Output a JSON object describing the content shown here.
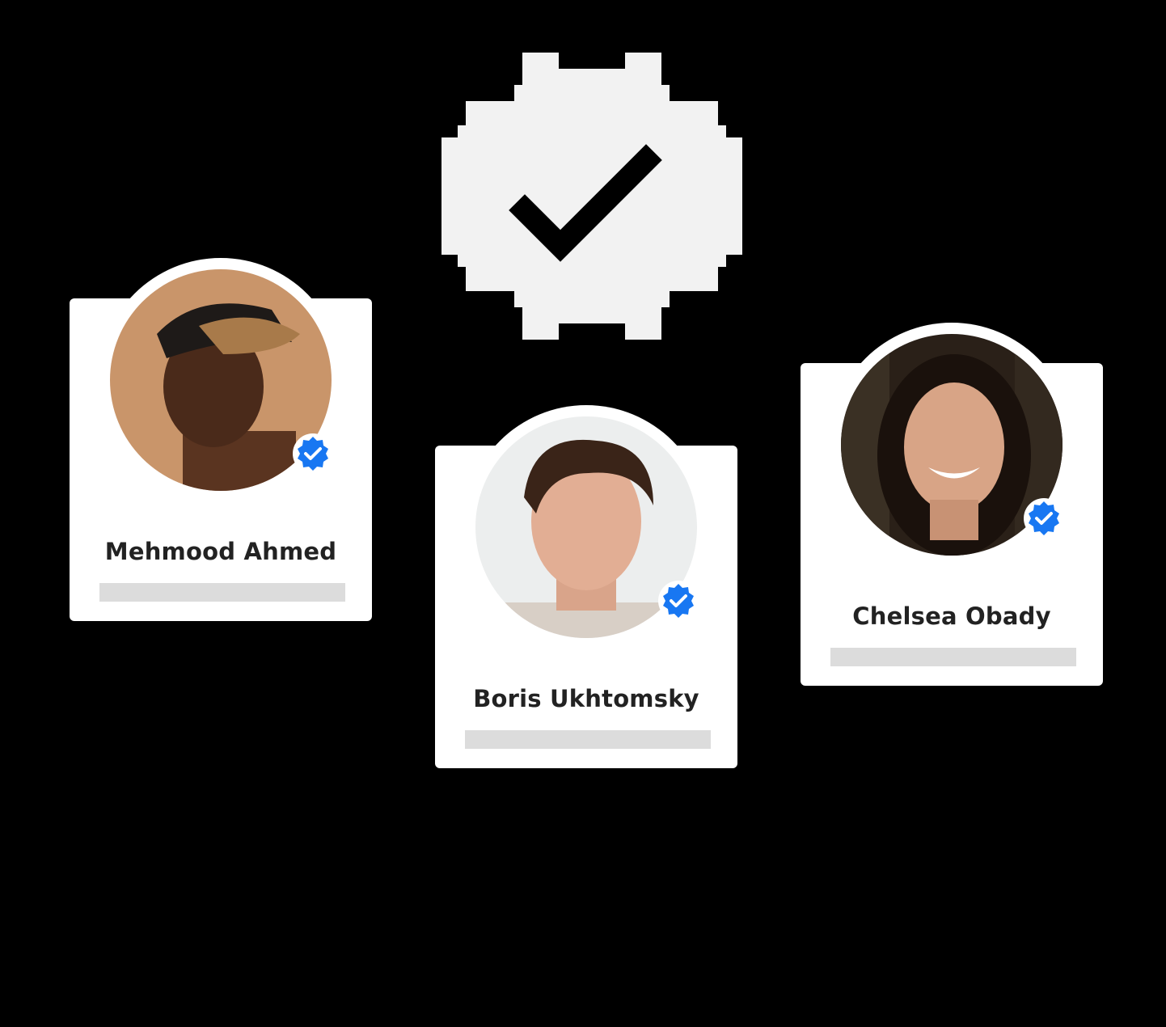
{
  "colors": {
    "background": "#000000",
    "card": "#ffffff",
    "badge_large": "#f2f2f2",
    "verified_blue": "#1877f2",
    "placeholder": "#dcdcdc",
    "name_text": "#222222"
  },
  "hero_badge": {
    "icon": "verified-check-badge-icon"
  },
  "profiles": [
    {
      "name": "Mehmood Ahmed",
      "verified": true,
      "verified_icon": "verified-badge-icon"
    },
    {
      "name": "Boris Ukhtomsky",
      "verified": true,
      "verified_icon": "verified-badge-icon"
    },
    {
      "name": "Chelsea Obady",
      "verified": true,
      "verified_icon": "verified-badge-icon"
    }
  ]
}
